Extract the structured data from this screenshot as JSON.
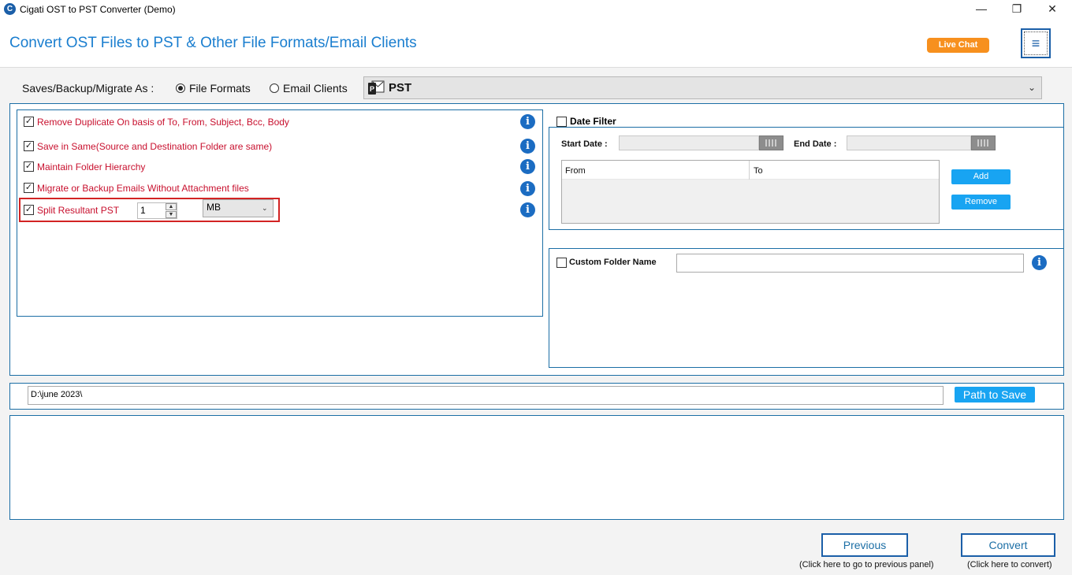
{
  "window": {
    "title": "Cigati OST to PST Converter (Demo)",
    "app_icon_glyph": "C",
    "minimize_glyph": "—",
    "maximize_glyph": "❐",
    "close_glyph": "✕"
  },
  "header": {
    "heading": "Convert OST Files to PST & Other File Formats/Email Clients",
    "live_chat_label": "Live Chat",
    "menu_glyph": "≡"
  },
  "saves": {
    "label": "Saves/Backup/Migrate As :",
    "options": [
      "File Formats",
      "Email Clients"
    ],
    "selected": "File Formats",
    "format_value": "PST",
    "chevron": "⌄"
  },
  "options": [
    {
      "label": "Remove Duplicate On basis of To, From, Subject, Bcc, Body",
      "checked": true
    },
    {
      "label": "Save in Same(Source and Destination Folder are same)",
      "checked": true
    },
    {
      "label": "Maintain Folder Hierarchy",
      "checked": true
    },
    {
      "label": "Migrate or Backup Emails Without Attachment files",
      "checked": true
    },
    {
      "label": "Split Resultant PST",
      "checked": true
    }
  ],
  "split": {
    "size_value": "1",
    "unit_value": "MB",
    "spin_up": "▲",
    "spin_down": "▼",
    "chevron": "⌄"
  },
  "info_glyph": "i",
  "check_glyph": "✓",
  "date_filter": {
    "label": "Date Filter",
    "checked": false,
    "start_label": "Start Date :",
    "end_label": "End Date :",
    "columns": [
      "From",
      "To"
    ],
    "add_label": "Add",
    "remove_label": "Remove"
  },
  "custom_folder": {
    "label": "Custom Folder Name",
    "checked": false,
    "value": ""
  },
  "path": {
    "value": "D:\\june 2023\\",
    "button_label": "Path to Save"
  },
  "footer": {
    "previous_label": "Previous",
    "previous_hint": "(Click here to go to previous panel)",
    "convert_label": "Convert",
    "convert_hint": "(Click here to convert)"
  },
  "colors": {
    "accent": "#1a7ecf",
    "option_text": "#c8102e",
    "live_chat": "#f7901e",
    "button_blue": "#18a4f2",
    "highlight_box": "#d22323"
  }
}
